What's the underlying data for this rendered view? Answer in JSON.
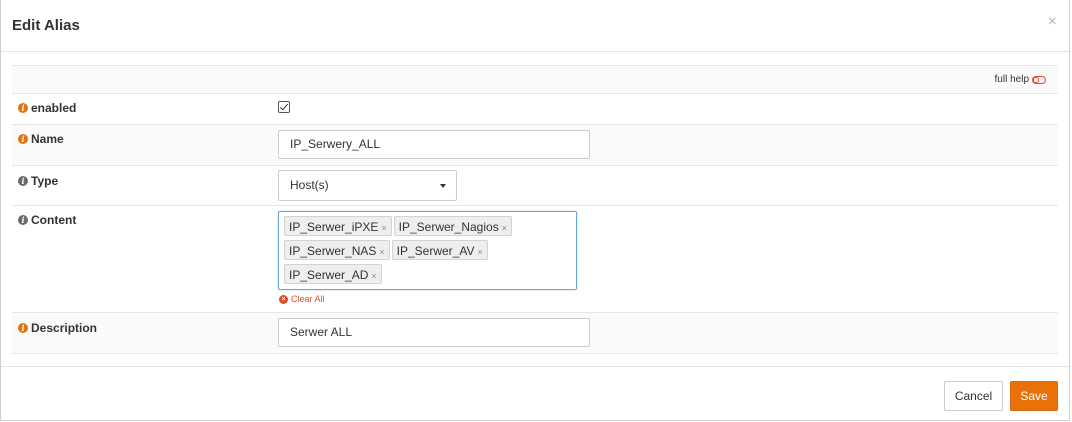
{
  "dialog": {
    "title": "Edit Alias",
    "close_glyph": "×"
  },
  "full_help": {
    "label": "full help"
  },
  "fields": {
    "enabled": {
      "label": "enabled",
      "checked": true
    },
    "name": {
      "label": "Name",
      "value": "IP_Serwery_ALL"
    },
    "type": {
      "label": "Type",
      "value": "Host(s)"
    },
    "content": {
      "label": "Content",
      "tags": [
        "IP_Serwer_iPXE",
        "IP_Serwer_Nagios",
        "IP_Serwer_NAS",
        "IP_Serwer_AV",
        "IP_Serwer_AD"
      ],
      "clear_all": "Clear All"
    },
    "description": {
      "label": "Description",
      "value": "Serwer ALL"
    }
  },
  "info_glyph": "i",
  "tag_remove_glyph": "×",
  "clear_glyph": "×",
  "buttons": {
    "cancel": "Cancel",
    "save": "Save"
  },
  "colors": {
    "accent": "#e8710a",
    "danger": "#e24c2b",
    "focus_border": "#6aa4d8"
  }
}
